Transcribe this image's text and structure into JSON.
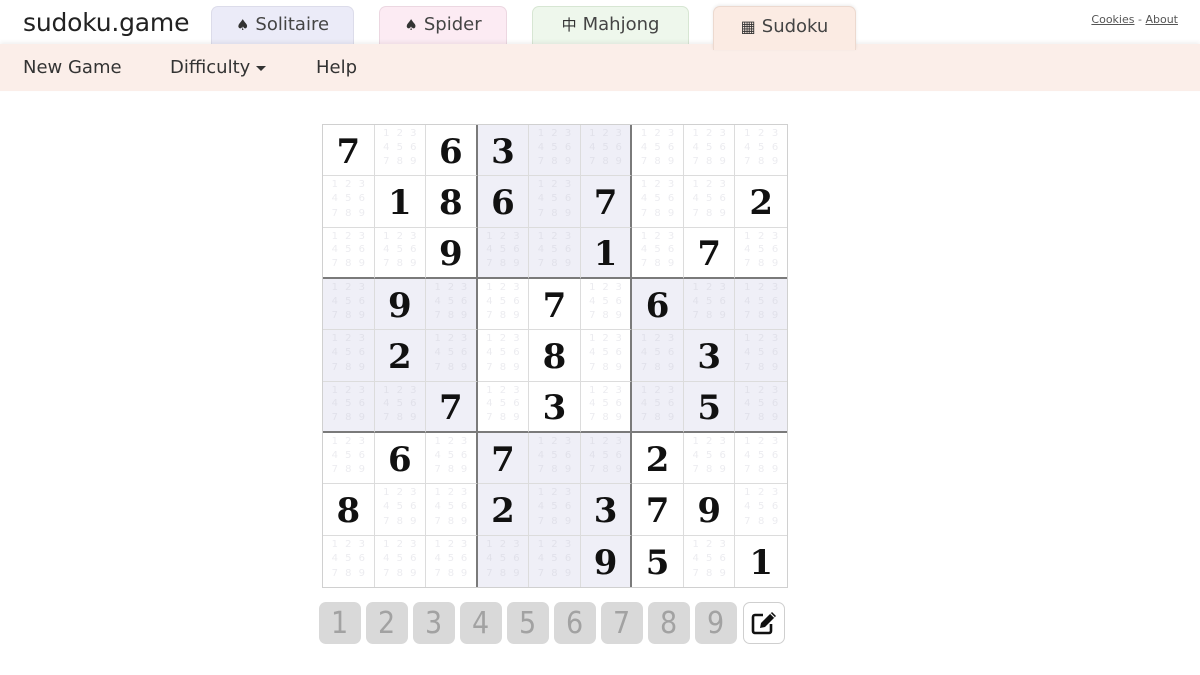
{
  "header": {
    "logo": "sudoku.game",
    "tabs": [
      {
        "label": "Solitaire",
        "icon": "spade-icon",
        "glyph": "♠",
        "color": "#ebebf8",
        "active": false
      },
      {
        "label": "Spider",
        "icon": "spade-icon",
        "glyph": "♠",
        "color": "#fcebf3",
        "active": false
      },
      {
        "label": "Mahjong",
        "icon": "mahjong-zhong-icon",
        "glyph": "中",
        "color": "#eef7ec",
        "active": false
      },
      {
        "label": "Sudoku",
        "icon": "grid-icon",
        "glyph": "▦",
        "color": "#fbebe3",
        "active": true
      }
    ],
    "links": {
      "cookies": "Cookies",
      "separator": "-",
      "about": "About"
    }
  },
  "menu": {
    "new_game": "New Game",
    "difficulty": "Difficulty",
    "help": "Help",
    "background": "#fbeee9"
  },
  "board": {
    "shaded_box_color": "#efeff7",
    "grid": [
      [
        7,
        0,
        6,
        3,
        0,
        0,
        0,
        0,
        0
      ],
      [
        0,
        1,
        8,
        6,
        0,
        7,
        0,
        0,
        2
      ],
      [
        0,
        0,
        9,
        0,
        0,
        1,
        0,
        7,
        0
      ],
      [
        0,
        9,
        0,
        0,
        7,
        0,
        6,
        0,
        0
      ],
      [
        0,
        2,
        0,
        0,
        8,
        0,
        0,
        3,
        0
      ],
      [
        0,
        0,
        7,
        0,
        3,
        0,
        0,
        5,
        0
      ],
      [
        0,
        6,
        0,
        7,
        0,
        0,
        2,
        0,
        0
      ],
      [
        8,
        0,
        0,
        2,
        0,
        3,
        7,
        9,
        0
      ],
      [
        0,
        0,
        0,
        0,
        0,
        9,
        5,
        0,
        1
      ]
    ],
    "note_candidates": [
      "1",
      "2",
      "3",
      "4",
      "5",
      "6",
      "7",
      "8",
      "9"
    ]
  },
  "numpad": {
    "buttons": [
      "1",
      "2",
      "3",
      "4",
      "5",
      "6",
      "7",
      "8",
      "9"
    ],
    "pencil_icon": "pencil-edit-icon"
  }
}
